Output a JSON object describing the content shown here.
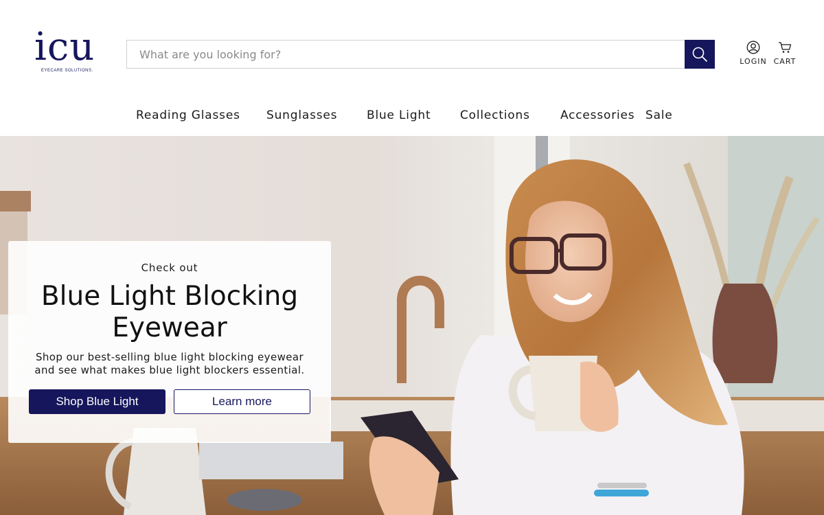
{
  "brand": {
    "name": "icu",
    "tagline": "EYECARE SOLUTIONS.",
    "color": "#16165c"
  },
  "search": {
    "placeholder": "What are you looking for?",
    "button_icon": "search-icon"
  },
  "header": {
    "login_label": "LOGIN",
    "login_icon": "user-icon",
    "cart_label": "CART",
    "cart_icon": "cart-icon"
  },
  "nav": {
    "items": [
      {
        "label": "Reading Glasses"
      },
      {
        "label": "Sunglasses"
      },
      {
        "label": "Blue Light"
      },
      {
        "label": "Collections"
      },
      {
        "label": "Accessories"
      },
      {
        "label": "Sale"
      }
    ]
  },
  "hero": {
    "kicker": "Check out",
    "title_line1": "Blue Light Blocking",
    "title_line2": "Eyewear",
    "description_line1": "Shop our best-selling blue light blocking eyewear",
    "description_line2": "and see what makes blue light blockers essential.",
    "primary_button": "Shop Blue Light",
    "secondary_button": "Learn more",
    "image": "woman-in-glasses-with-coffee-and-phone"
  }
}
